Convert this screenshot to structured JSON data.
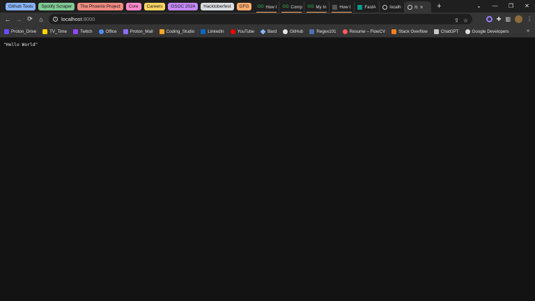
{
  "tab_groups": [
    {
      "label": "Github Tools",
      "color": "#8ab4f8"
    },
    {
      "label": "Spotify Scraper",
      "color": "#81c995"
    },
    {
      "label": "The Phoenix Project",
      "color": "#f28b82"
    },
    {
      "label": "Core",
      "color": "#ff8bcb"
    },
    {
      "label": "Careers",
      "color": "#fdd663"
    },
    {
      "label": "GSOC 2024",
      "color": "#c58af9"
    },
    {
      "label": "Hacktoberfest",
      "color": "#dadce0"
    },
    {
      "label": "GFG",
      "color": "#fcad70"
    }
  ],
  "tabs": [
    {
      "title": "How t",
      "icon": "gfg-icon",
      "underline": "#fcad70"
    },
    {
      "title": "Comp",
      "icon": "gfg-icon",
      "underline": "#fcad70"
    },
    {
      "title": "My In",
      "icon": "gfg-icon",
      "underline": "#fcad70"
    },
    {
      "title": "How t",
      "icon": "page-icon",
      "underline": "#fcad70"
    },
    {
      "title": "FastA",
      "icon": "fastapi-icon",
      "underline": ""
    },
    {
      "title": "localh",
      "icon": "globe-icon",
      "underline": ""
    },
    {
      "title": "lc",
      "icon": "globe-icon",
      "underline": "",
      "active": true
    }
  ],
  "new_tab_glyph": "+",
  "window_controls": {
    "tab_search": "⌄",
    "minimize": "—",
    "maximize": "❐",
    "close": "✕"
  },
  "toolbar": {
    "back": "←",
    "forward": "→",
    "reload": "⟳",
    "home": "⌂",
    "info": "i",
    "url_host": "localhost",
    "url_port": ":8000",
    "share": "⇪",
    "bookmark_star": "☆",
    "extensions": "✚",
    "side_panel": "▥",
    "menu": "⋮"
  },
  "bookmarks": [
    {
      "label": "Proton_Drive",
      "color": "#6d4aff"
    },
    {
      "label": "TV_Time",
      "color": "#ffd400"
    },
    {
      "label": "Twitch",
      "color": "#9146ff"
    },
    {
      "label": "Office",
      "color": "#4f8ef7"
    },
    {
      "label": "Proton_Mail",
      "color": "#8b6cff"
    },
    {
      "label": "Coding_Studio",
      "color": "#f5a623"
    },
    {
      "label": "LinkedIn",
      "color": "#0a66c2"
    },
    {
      "label": "YouTube",
      "color": "#ff0000"
    },
    {
      "label": "Bard",
      "color": "#8ab4f8"
    },
    {
      "label": "GitHub",
      "color": "#e6e6e6"
    },
    {
      "label": "Regex101",
      "color": "#4f6fb0"
    },
    {
      "label": "Resume – FlowCV",
      "color": "#ff5a5f"
    },
    {
      "label": "Stack Overflow",
      "color": "#f48024"
    },
    {
      "label": "ChatGPT",
      "color": "#c8c8c8"
    },
    {
      "label": "Google Developers",
      "color": "#e0e0e0"
    }
  ],
  "bookmarks_more": "»",
  "page": {
    "content": "\"Hello World\""
  }
}
